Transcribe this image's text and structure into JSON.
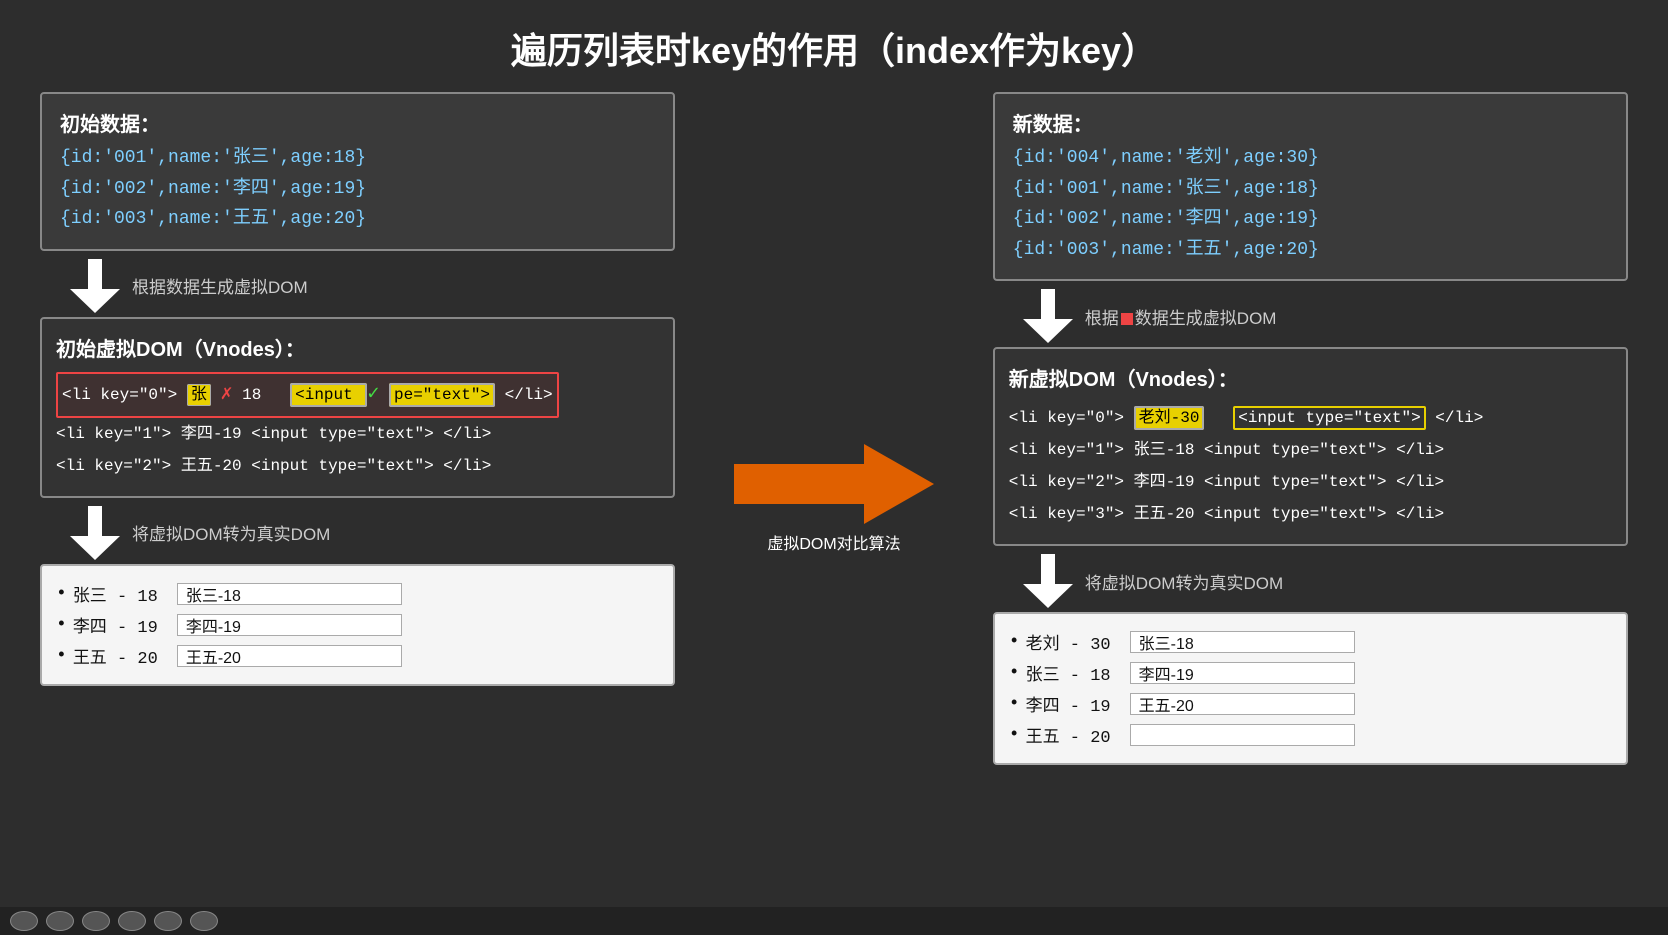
{
  "title": "遍历列表时key的作用（index作为key）",
  "left": {
    "data_box": {
      "label": "初始数据：",
      "lines": [
        "{id:'001',name:'张三',age:18}",
        "{id:'002',name:'李四',age:19}",
        "{id:'003',name:'王五',age:20}"
      ]
    },
    "arrow1_label": "根据数据生成虚拟DOM",
    "vdom_box": {
      "label": "初始虚拟DOM（Vnodes）：",
      "rows": [
        {
          "key": "0",
          "name": "张",
          "age": "18",
          "highlighted": true
        },
        {
          "key": "1",
          "name": "李四",
          "age": "19",
          "highlighted": false
        },
        {
          "key": "2",
          "name": "王五",
          "age": "20",
          "highlighted": false
        }
      ]
    },
    "arrow2_label": "将虚拟DOM转为真实DOM",
    "realdom_box": {
      "rows": [
        {
          "bullet": "•",
          "label": "张三 - 18",
          "input_val": "张三-18"
        },
        {
          "bullet": "•",
          "label": "李四 - 19",
          "input_val": "李四-19"
        },
        {
          "bullet": "•",
          "label": "王五 - 20",
          "input_val": "王五-20"
        }
      ]
    }
  },
  "middle": {
    "arrow_label": "虚拟DOM对比算法"
  },
  "right": {
    "data_box": {
      "label": "新数据：",
      "lines": [
        "{id:'004',name:'老刘',age:30}",
        "{id:'001',name:'张三',age:18}",
        "{id:'002',name:'李四',age:19}",
        "{id:'003',name:'王五',age:20}"
      ]
    },
    "arrow1_label": "根据",
    "arrow1_label2": "数据生成虚拟DOM",
    "vdom_box": {
      "label": "新虚拟DOM（Vnodes）：",
      "rows": [
        {
          "key": "0",
          "name": "老刘-30",
          "highlighted": true
        },
        {
          "key": "1",
          "name": "张三-18",
          "highlighted": false
        },
        {
          "key": "2",
          "name": "李四-19",
          "highlighted": false
        },
        {
          "key": "3",
          "name": "王五-20",
          "highlighted": false
        }
      ]
    },
    "arrow2_label": "将虚拟DOM转为真实DOM",
    "realdom_box": {
      "rows": [
        {
          "bullet": "•",
          "label": "老刘 - 30",
          "input_val": "张三-18"
        },
        {
          "bullet": "•",
          "label": "张三 - 18",
          "input_val": "李四-19"
        },
        {
          "bullet": "•",
          "label": "李四 - 19",
          "input_val": "王五-20"
        },
        {
          "bullet": "•",
          "label": "王五 - 20",
          "input_val": ""
        }
      ]
    }
  },
  "bottom_buttons": [
    "⏮",
    "⏪",
    "⏩",
    "⏭",
    "⏺",
    "⏹"
  ]
}
